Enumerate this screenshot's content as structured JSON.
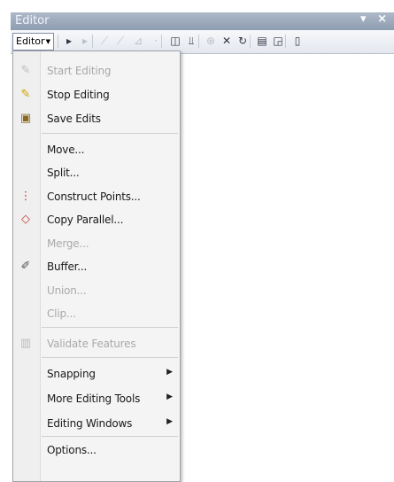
{
  "window": {
    "title": "Editor",
    "controls": "▾ ×"
  },
  "toolbar": {
    "editor_label": "Editor",
    "tools": [
      {
        "icon": "edit-tool-icon",
        "glyph": "▸",
        "enabled": true
      },
      {
        "icon": "edit-annotation-icon",
        "glyph": "▸",
        "enabled": false
      },
      {
        "icon": "straight-segment-icon",
        "glyph": "⟋",
        "enabled": false
      },
      {
        "icon": "end-point-arc-icon",
        "glyph": "⟋",
        "enabled": false
      },
      {
        "icon": "trace-icon",
        "glyph": "⊿",
        "enabled": false
      },
      {
        "icon": "point-icon",
        "glyph": "·",
        "enabled": false
      },
      {
        "icon": "edit-vertices-icon",
        "glyph": "◫",
        "enabled": true
      },
      {
        "icon": "reshape-feature-icon",
        "glyph": "⫫",
        "enabled": true
      },
      {
        "icon": "cut-polygons-icon",
        "glyph": "⊕",
        "enabled": false
      },
      {
        "icon": "split-tool-icon",
        "glyph": "✕",
        "enabled": true
      },
      {
        "icon": "rotate-icon",
        "glyph": "↻",
        "enabled": true
      },
      {
        "icon": "attributes-icon",
        "glyph": "▤",
        "enabled": true
      },
      {
        "icon": "sketch-properties-icon",
        "glyph": "◲",
        "enabled": true
      },
      {
        "icon": "create-features-icon",
        "glyph": "▯",
        "enabled": true
      }
    ]
  },
  "menu": {
    "items": [
      {
        "label": "Start Editing",
        "icon": "pencil-icon",
        "glyph": "✎",
        "enabled": false
      },
      {
        "label": "Stop Editing",
        "icon": "stop-editing-icon",
        "glyph": "✎",
        "enabled": true
      },
      {
        "label": "Save Edits",
        "icon": "save-icon",
        "glyph": "▣",
        "enabled": true
      },
      {
        "label": "Move...",
        "icon": "",
        "glyph": "",
        "enabled": true
      },
      {
        "label": "Split...",
        "icon": "",
        "glyph": "",
        "enabled": true
      },
      {
        "label": "Construct Points...",
        "icon": "construct-points-icon",
        "glyph": "⋮",
        "enabled": true
      },
      {
        "label": "Copy Parallel...",
        "icon": "copy-parallel-icon",
        "glyph": "◇",
        "enabled": true
      },
      {
        "label": "Merge...",
        "icon": "",
        "glyph": "",
        "enabled": false
      },
      {
        "label": "Buffer...",
        "icon": "buffer-icon",
        "glyph": "✐",
        "enabled": true
      },
      {
        "label": "Union...",
        "icon": "",
        "glyph": "",
        "enabled": false
      },
      {
        "label": "Clip...",
        "icon": "",
        "glyph": "",
        "enabled": false
      },
      {
        "label": "Validate Features",
        "icon": "validate-features-icon",
        "glyph": "▥",
        "enabled": false
      },
      {
        "label": "Snapping",
        "icon": "",
        "glyph": "",
        "enabled": true,
        "submenu": true
      },
      {
        "label": "More Editing Tools",
        "icon": "",
        "glyph": "",
        "enabled": true,
        "submenu": true
      },
      {
        "label": "Editing Windows",
        "icon": "",
        "glyph": "",
        "enabled": true,
        "submenu": true
      },
      {
        "label": "Options...",
        "icon": "",
        "glyph": "",
        "enabled": true
      }
    ]
  },
  "colors": {
    "titlebar": "#9aa7b9",
    "menu_bg": "#f4f4f4",
    "disabled_text": "#a9a9a9"
  }
}
